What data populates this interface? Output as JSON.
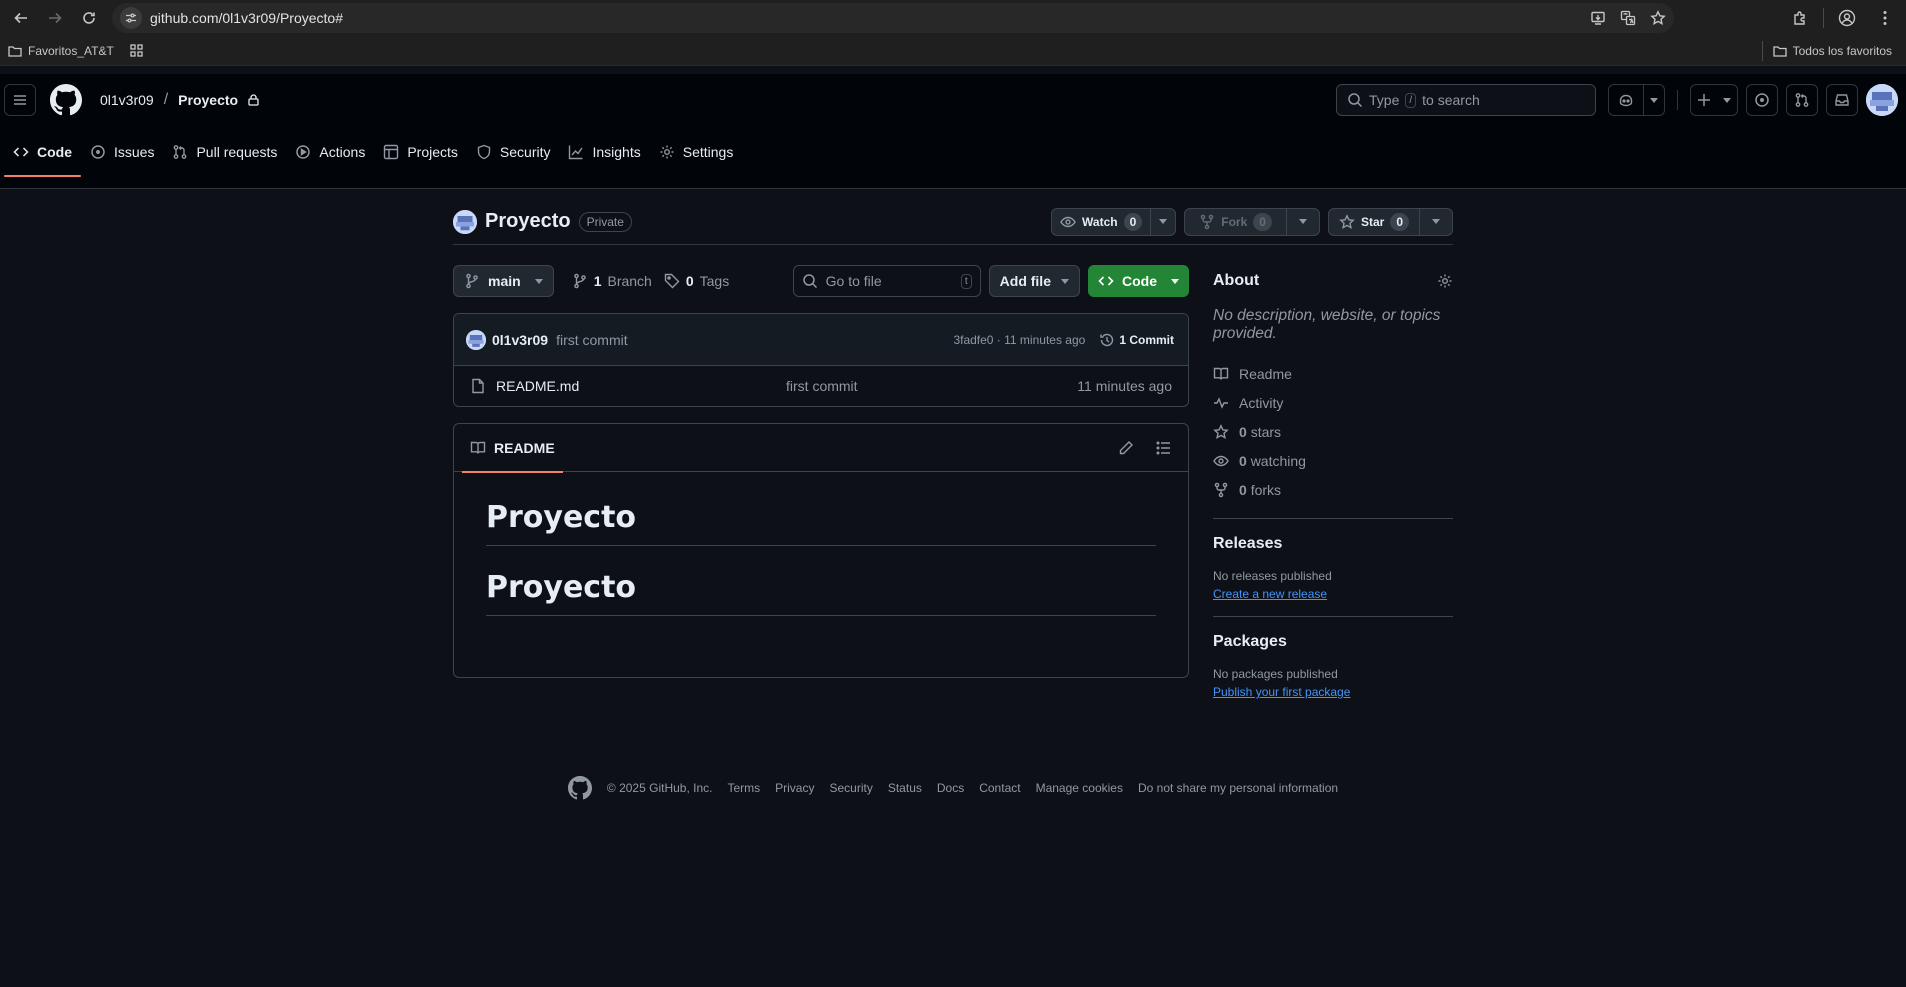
{
  "browser": {
    "url": "github.com/0l1v3r09/Proyecto#",
    "bookmarks": {
      "left_label": "Favoritos_AT&T",
      "right_label": "Todos los favoritos"
    }
  },
  "header": {
    "owner": "0l1v3r09",
    "separator": "/",
    "repo": "Proyecto",
    "search": {
      "before": "Type",
      "key": "/",
      "after": "to search"
    }
  },
  "tabs": [
    {
      "label": "Code",
      "icon": "code-icon"
    },
    {
      "label": "Issues",
      "icon": "issue-icon"
    },
    {
      "label": "Pull requests",
      "icon": "pull-request-icon"
    },
    {
      "label": "Actions",
      "icon": "play-icon"
    },
    {
      "label": "Projects",
      "icon": "table-icon"
    },
    {
      "label": "Security",
      "icon": "shield-icon"
    },
    {
      "label": "Insights",
      "icon": "graph-icon"
    },
    {
      "label": "Settings",
      "icon": "gear-icon"
    }
  ],
  "repo_head": {
    "name": "Proyecto",
    "visibility": "Private",
    "watch": {
      "label": "Watch",
      "count": "0"
    },
    "fork": {
      "label": "Fork",
      "count": "0"
    },
    "star": {
      "label": "Star",
      "count": "0"
    }
  },
  "toolbar": {
    "branch": "main",
    "branches_count": "1",
    "branches_label": "Branch",
    "tags_count": "0",
    "tags_label": "Tags",
    "goto_placeholder": "Go to file",
    "goto_key": "t",
    "add_file": "Add file",
    "code": "Code"
  },
  "commit": {
    "user": "0l1v3r09",
    "message": "first commit",
    "meta": "3fadfe0 · 11 minutes ago",
    "count": "1 Commit"
  },
  "files": [
    {
      "name": "README.md",
      "message": "first commit",
      "age": "11 minutes ago"
    }
  ],
  "readme": {
    "tab": "README",
    "headings": [
      "Proyecto",
      "Proyecto"
    ]
  },
  "about": {
    "title": "About",
    "description": "No description, website, or topics provided.",
    "items": [
      {
        "icon": "book-icon",
        "count": "",
        "label": "Readme"
      },
      {
        "icon": "pulse-icon",
        "count": "",
        "label": "Activity"
      },
      {
        "icon": "star-icon",
        "count": "0",
        "label": "stars"
      },
      {
        "icon": "eye-icon",
        "count": "0",
        "label": "watching"
      },
      {
        "icon": "fork-icon",
        "count": "0",
        "label": "forks"
      }
    ]
  },
  "releases": {
    "title": "Releases",
    "empty": "No releases published",
    "link": "Create a new release"
  },
  "packages": {
    "title": "Packages",
    "empty": "No packages published",
    "link": "Publish your first package"
  },
  "footer": {
    "copyright": "© 2025 GitHub, Inc.",
    "links": [
      "Terms",
      "Privacy",
      "Security",
      "Status",
      "Docs",
      "Contact",
      "Manage cookies",
      "Do not share my personal information"
    ]
  },
  "colors": {
    "accent_green": "#238636",
    "tab_underline": "#f78166",
    "link": "#4493f8",
    "background": "#0d1117"
  }
}
